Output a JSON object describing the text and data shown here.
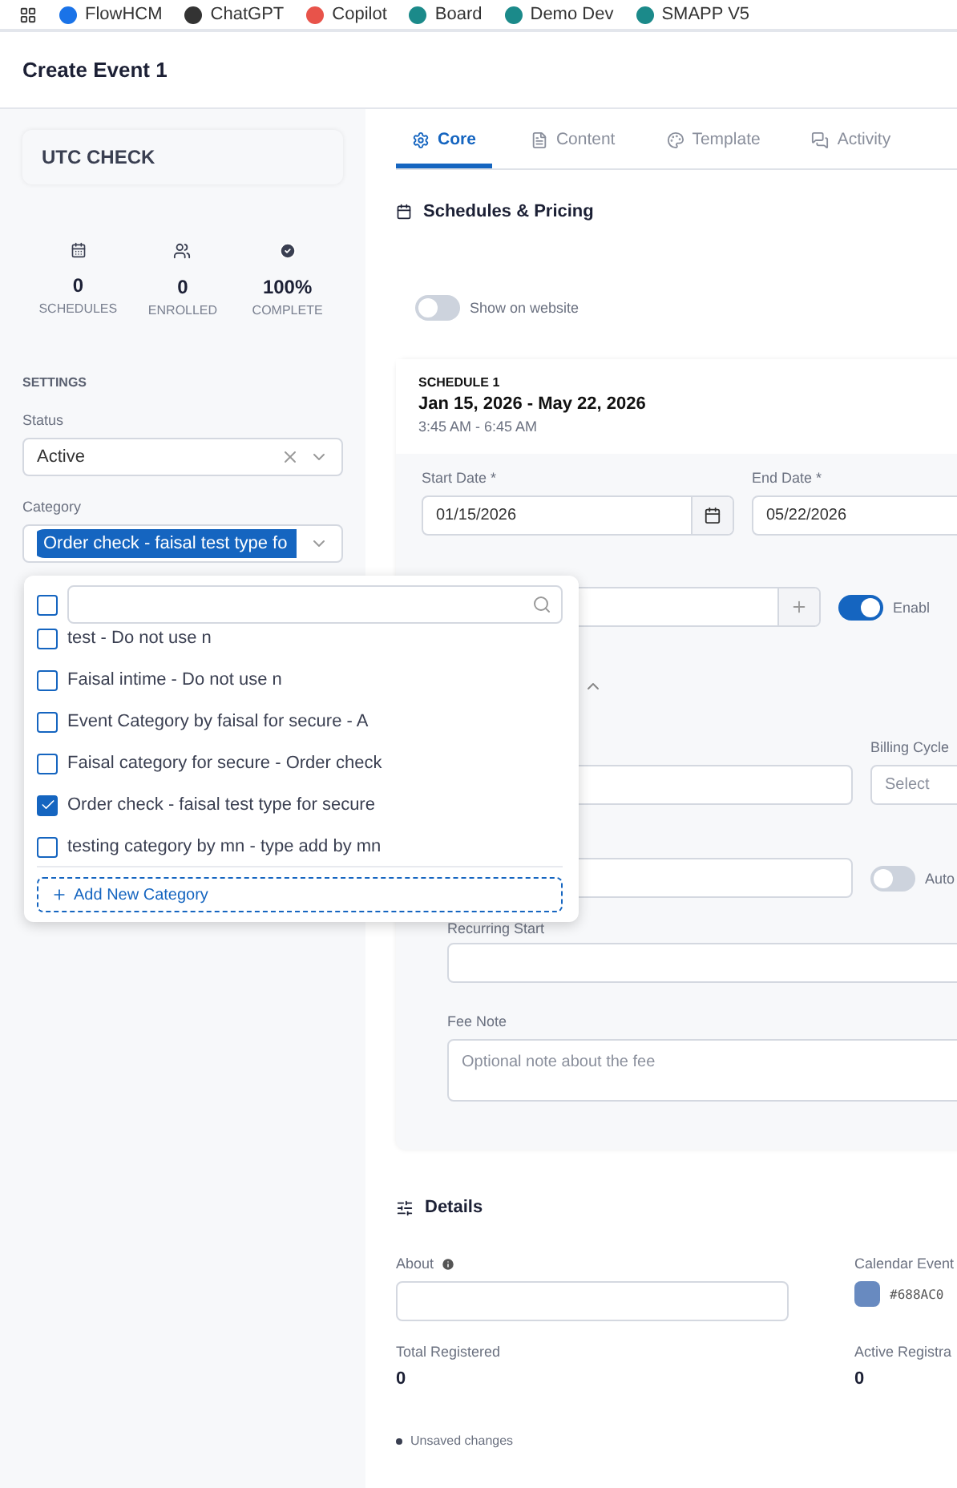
{
  "bookmarks": [
    {
      "label": "FlowHCM",
      "color": "#1a73e8"
    },
    {
      "label": "ChatGPT",
      "color": "#333333"
    },
    {
      "label": "Copilot",
      "color": "#e8534a"
    },
    {
      "label": "Board",
      "color": "#1b8a8a"
    },
    {
      "label": "Demo Dev",
      "color": "#1b8a8a"
    },
    {
      "label": "SMAPP V5",
      "color": "#1b8a8a"
    }
  ],
  "page_title": "Create Event 1",
  "sidebar": {
    "event_name": "UTC CHECK",
    "stats": [
      {
        "kind": "calendar",
        "value": "0",
        "label": "SCHEDULES"
      },
      {
        "kind": "users",
        "value": "0",
        "label": "ENROLLED"
      },
      {
        "kind": "check",
        "value": "100%",
        "label": "COMPLETE"
      }
    ],
    "settings_heading": "SETTINGS",
    "status": {
      "label": "Status",
      "value": "Active"
    },
    "category": {
      "label": "Category",
      "chip": "Order check - faisal test type fo",
      "dropdown": {
        "expanded": true,
        "select_all_checked": false,
        "options": [
          {
            "label": "test - Do not use n",
            "checked": false
          },
          {
            "label": "Faisal intime - Do not use n",
            "checked": false
          },
          {
            "label": "Event Category by faisal for secure - A",
            "checked": false
          },
          {
            "label": "Faisal category for secure - Order check",
            "checked": false
          },
          {
            "label": "Order check - faisal test type for secure",
            "checked": true
          },
          {
            "label": "testing category by mn - type add by mn",
            "checked": false
          }
        ],
        "add_button": "Add New Category"
      }
    }
  },
  "tabs": [
    {
      "kind": "gear",
      "label": "Core",
      "selected": true
    },
    {
      "kind": "file",
      "label": "Content",
      "selected": false
    },
    {
      "kind": "palette",
      "label": "Template",
      "selected": false
    },
    {
      "kind": "chat",
      "label": "Activity",
      "selected": false
    }
  ],
  "schedules": {
    "title": "Schedules & Pricing",
    "show_on_website": {
      "label": "Show on website",
      "on": false
    },
    "schedule": {
      "heading": "SCHEDULE 1",
      "range": "Jan 15, 2026 - May 22, 2026",
      "time": "3:45 AM - 6:45 AM",
      "start_date": {
        "label": "Start Date *",
        "value": "01/15/2026"
      },
      "end_date": {
        "label": "End Date *",
        "value": "05/22/2026"
      },
      "enable_toggle": {
        "label": "Enabl",
        "on": true
      },
      "billing_cycle": {
        "label": "Billing Cycle",
        "placeholder": "Select"
      },
      "auto_toggle": {
        "label": "Auto",
        "on": false
      },
      "recurring_start": {
        "label": "Recurring Start"
      },
      "fee_note": {
        "label": "Fee Note",
        "placeholder": "Optional note about the fee"
      }
    }
  },
  "details": {
    "title": "Details",
    "about": {
      "label": "About"
    },
    "calendar_event": {
      "label": "Calendar Event",
      "color": "#688ac0",
      "value": "#688AC0"
    },
    "total_registered": {
      "label": "Total Registered",
      "value": "0"
    },
    "active_registrations": {
      "label": "Active Registra",
      "value": "0"
    }
  },
  "status_note": "Unsaved changes"
}
